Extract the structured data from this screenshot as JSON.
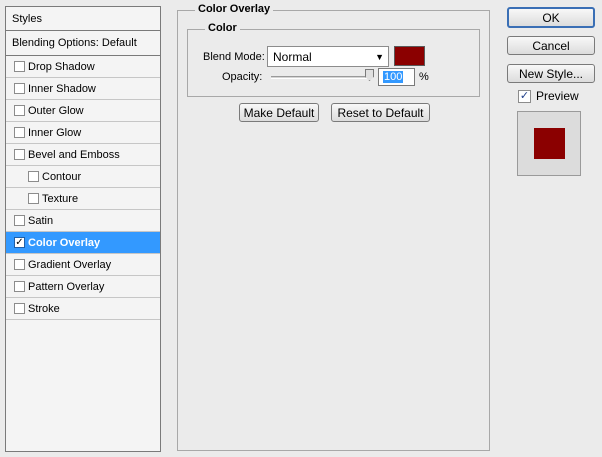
{
  "styles_panel": {
    "header": "Styles",
    "blending_options": "Blending Options: Default",
    "items": [
      {
        "label": "Drop Shadow",
        "checked": false
      },
      {
        "label": "Inner Shadow",
        "checked": false
      },
      {
        "label": "Outer Glow",
        "checked": false
      },
      {
        "label": "Inner Glow",
        "checked": false
      },
      {
        "label": "Bevel and Emboss",
        "checked": false
      },
      {
        "label": "Contour",
        "checked": false,
        "indent": true
      },
      {
        "label": "Texture",
        "checked": false,
        "indent": true
      },
      {
        "label": "Satin",
        "checked": false
      },
      {
        "label": "Color Overlay",
        "checked": true,
        "selected": true
      },
      {
        "label": "Gradient Overlay",
        "checked": false
      },
      {
        "label": "Pattern Overlay",
        "checked": false
      },
      {
        "label": "Stroke",
        "checked": false
      }
    ]
  },
  "color_overlay": {
    "title": "Color Overlay",
    "group_title": "Color",
    "blend_mode_label": "Blend Mode:",
    "blend_mode_value": "Normal",
    "overlay_color": "#8b0000",
    "opacity_label": "Opacity:",
    "opacity_value": "100",
    "opacity_unit": "%",
    "make_default_label": "Make Default",
    "reset_default_label": "Reset to Default"
  },
  "actions": {
    "ok_label": "OK",
    "cancel_label": "Cancel",
    "new_style_label": "New Style...",
    "preview_label": "Preview",
    "preview_checked": true,
    "preview_color": "#8b0000"
  },
  "icons": {
    "check": "check-icon",
    "dropdown": "triangle-down-icon"
  }
}
